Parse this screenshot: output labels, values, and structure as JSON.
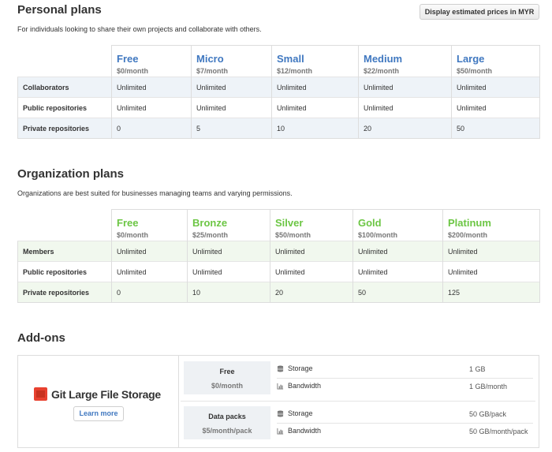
{
  "personal": {
    "title": "Personal plans",
    "description": "For individuals looking to share their own projects and collaborate with others.",
    "currency_button": "Display estimated prices in MYR",
    "plans": [
      {
        "name": "Free",
        "price": "$0/month"
      },
      {
        "name": "Micro",
        "price": "$7/month"
      },
      {
        "name": "Small",
        "price": "$12/month"
      },
      {
        "name": "Medium",
        "price": "$22/month"
      },
      {
        "name": "Large",
        "price": "$50/month"
      }
    ],
    "rows": [
      {
        "label": "Collaborators",
        "values": [
          "Unlimited",
          "Unlimited",
          "Unlimited",
          "Unlimited",
          "Unlimited"
        ]
      },
      {
        "label": "Public repositories",
        "values": [
          "Unlimited",
          "Unlimited",
          "Unlimited",
          "Unlimited",
          "Unlimited"
        ]
      },
      {
        "label": "Private repositories",
        "values": [
          "0",
          "5",
          "10",
          "20",
          "50"
        ]
      }
    ]
  },
  "organization": {
    "title": "Organization plans",
    "description": "Organizations are best suited for businesses managing teams and varying permissions.",
    "plans": [
      {
        "name": "Free",
        "price": "$0/month"
      },
      {
        "name": "Bronze",
        "price": "$25/month"
      },
      {
        "name": "Silver",
        "price": "$50/month"
      },
      {
        "name": "Gold",
        "price": "$100/month"
      },
      {
        "name": "Platinum",
        "price": "$200/month"
      }
    ],
    "rows": [
      {
        "label": "Members",
        "values": [
          "Unlimited",
          "Unlimited",
          "Unlimited",
          "Unlimited",
          "Unlimited"
        ]
      },
      {
        "label": "Public repositories",
        "values": [
          "Unlimited",
          "Unlimited",
          "Unlimited",
          "Unlimited",
          "Unlimited"
        ]
      },
      {
        "label": "Private repositories",
        "values": [
          "0",
          "10",
          "20",
          "50",
          "125"
        ]
      }
    ]
  },
  "addons": {
    "title": "Add-ons",
    "product": "Git Large File Storage",
    "learn_more": "Learn more",
    "packs": [
      {
        "name": "Free",
        "price": "$0/month",
        "features": [
          {
            "label": "Storage",
            "icon": "database-icon",
            "value": "1 GB"
          },
          {
            "label": "Bandwidth",
            "icon": "graph-icon",
            "value": "1 GB/month"
          }
        ]
      },
      {
        "name": "Data packs",
        "price": "$5/month/pack",
        "features": [
          {
            "label": "Storage",
            "icon": "database-icon",
            "value": "50 GB/pack"
          },
          {
            "label": "Bandwidth",
            "icon": "graph-icon",
            "value": "50 GB/month/pack"
          }
        ]
      }
    ]
  },
  "colors": {
    "personal_accent": "#4078c0",
    "org_accent": "#6cc644",
    "lfs_brand": "#e8412f"
  }
}
